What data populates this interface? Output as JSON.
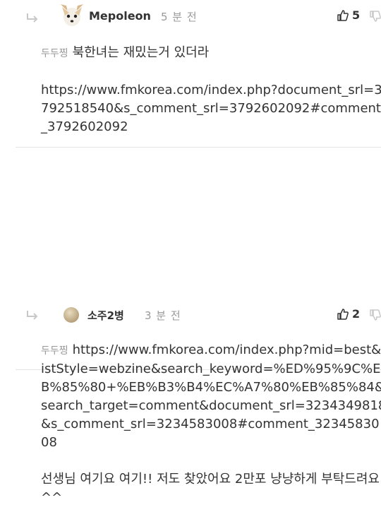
{
  "comments": [
    {
      "nickname": "Mepoleon",
      "time": "5 분 전",
      "likes": "5",
      "mention": "두두찡",
      "line1": "북한녀는 재밌는거 있더라",
      "url": "https://www.fmkorea.com/index.php?document_srl=3792518540&s_comment_srl=3792602092#comment_3792602092",
      "icons": {
        "reply": "reply-arrow-icon",
        "like": "thumbs-up-icon",
        "dislike": "thumbs-down-icon"
      }
    },
    {
      "nickname": "소주2병",
      "time": "3 분 전",
      "likes": "2",
      "mention": "두두찡",
      "url": "https://www.fmkorea.com/index.php?mid=best&listStyle=webzine&search_keyword=%ED%95%9C%EB%85%80+%EB%B3%B4%EC%A7%80%EB%85%84&search_target=comment&document_srl=3234349818&s_comment_srl=3234583008#comment_3234583008",
      "line2": "선생님 여기요 여기!! 저도 찾았어요 2만포 냥냥하게 부탁드려요 ^^",
      "icons": {
        "reply": "reply-arrow-icon",
        "like": "thumbs-up-icon",
        "dislike": "thumbs-down-icon"
      }
    }
  ]
}
